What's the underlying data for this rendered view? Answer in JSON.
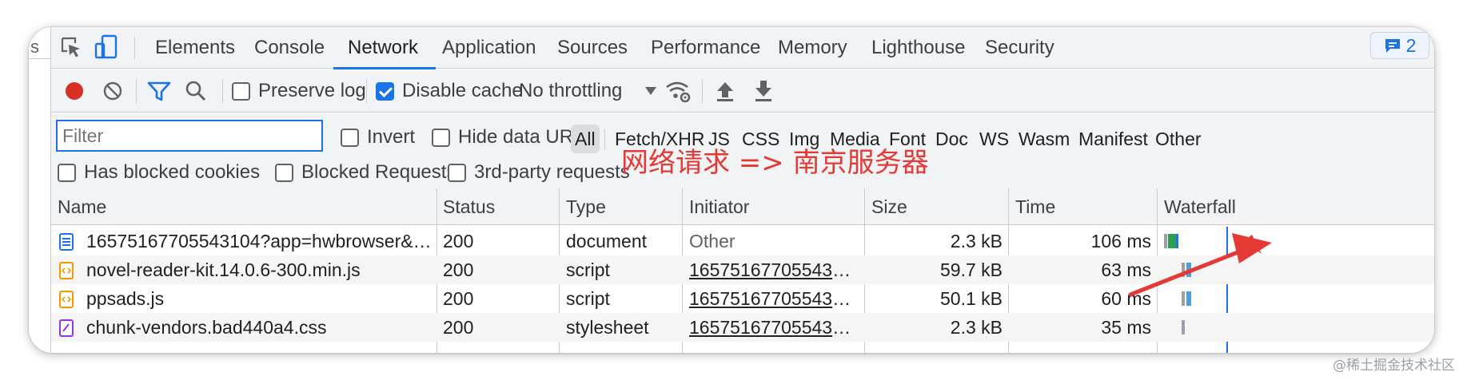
{
  "left_fragment": "s",
  "tabs": {
    "elements": "Elements",
    "console": "Console",
    "network": "Network",
    "application": "Application",
    "sources": "Sources",
    "performance": "Performance",
    "memory": "Memory",
    "lighthouse": "Lighthouse",
    "security": "Security",
    "active": "Network"
  },
  "issues_count": "2",
  "toolbar": {
    "preserve_log_label": "Preserve log",
    "preserve_log_checked": false,
    "disable_cache_label": "Disable cache",
    "disable_cache_checked": true,
    "throttling_value": "No throttling"
  },
  "filter": {
    "placeholder": "Filter",
    "invert_label": "Invert",
    "hide_data_urls_label": "Hide data URLs",
    "types": [
      "All",
      "Fetch/XHR",
      "JS",
      "CSS",
      "Img",
      "Media",
      "Font",
      "Doc",
      "WS",
      "Wasm",
      "Manifest",
      "Other"
    ],
    "has_blocked_cookies_label": "Has blocked cookies",
    "blocked_requests_label": "Blocked Requests",
    "third_party_label": "3rd-party requests"
  },
  "annotation_text": "网络请求 => 南京服务器",
  "columns": {
    "name": "Name",
    "status": "Status",
    "type": "Type",
    "initiator": "Initiator",
    "size": "Size",
    "time": "Time",
    "waterfall": "Waterfall"
  },
  "rows": [
    {
      "name": "16575167705543104?app=hwbrowser&spm…",
      "status": "200",
      "type": "document",
      "initiator": "Other",
      "size": "2.3 kB",
      "time": "106 ms",
      "kind": "document"
    },
    {
      "name": "novel-reader-kit.14.0.6-300.min.js",
      "status": "200",
      "type": "script",
      "initiator": "1657516770554310…",
      "size": "59.7 kB",
      "time": "63 ms",
      "kind": "script"
    },
    {
      "name": "ppsads.js",
      "status": "200",
      "type": "script",
      "initiator": "1657516770554310…",
      "size": "50.1 kB",
      "time": "60 ms",
      "kind": "script"
    },
    {
      "name": "chunk-vendors.bad440a4.css",
      "status": "200",
      "type": "stylesheet",
      "initiator": "1657516770554310…",
      "size": "2.3 kB",
      "time": "35 ms",
      "kind": "stylesheet"
    }
  ],
  "colors": {
    "accent": "#1a73e8",
    "record": "#d93025",
    "annotation": "#e53935"
  },
  "watermark": "@稀土掘金技术社区"
}
